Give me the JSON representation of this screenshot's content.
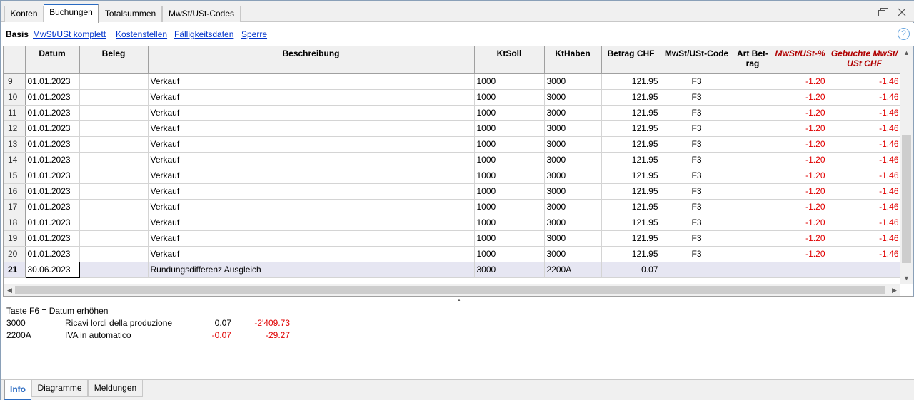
{
  "tabs": [
    {
      "label": "Konten"
    },
    {
      "label": "Buchungen"
    },
    {
      "label": "Totalsummen"
    },
    {
      "label": "MwSt/USt-Codes"
    }
  ],
  "active_tab": "Buchungen",
  "subnav": {
    "current": "Basis",
    "links": [
      "MwSt/USt komplett",
      "Kostenstellen",
      "Fälligkeitsdaten",
      "Sperre"
    ]
  },
  "table": {
    "columns": {
      "datum": "Datum",
      "beleg": "Beleg",
      "beschreibung": "Beschreibung",
      "ktsoll": "KtSoll",
      "kthaben": "KtHaben",
      "betrag": "Betrag CHF",
      "mwst_code": "MwSt/USt-Code",
      "art_betrag_1": "Art Bet-",
      "art_betrag_2": "rag",
      "mwst_pct": "MwSt/USt-%",
      "gebucht_1": "Gebuchte MwSt/",
      "gebucht_2": "USt CHF"
    },
    "rows": [
      {
        "n": "9",
        "datum": "01.01.2023",
        "beleg": "",
        "beschreibung": "Verkauf",
        "ktsoll": "1000",
        "kthaben": "3000",
        "betrag": "121.95",
        "code": "F3",
        "art": "",
        "pct": "-1.20",
        "gebucht": "-1.46"
      },
      {
        "n": "10",
        "datum": "01.01.2023",
        "beleg": "",
        "beschreibung": "Verkauf",
        "ktsoll": "1000",
        "kthaben": "3000",
        "betrag": "121.95",
        "code": "F3",
        "art": "",
        "pct": "-1.20",
        "gebucht": "-1.46"
      },
      {
        "n": "11",
        "datum": "01.01.2023",
        "beleg": "",
        "beschreibung": "Verkauf",
        "ktsoll": "1000",
        "kthaben": "3000",
        "betrag": "121.95",
        "code": "F3",
        "art": "",
        "pct": "-1.20",
        "gebucht": "-1.46"
      },
      {
        "n": "12",
        "datum": "01.01.2023",
        "beleg": "",
        "beschreibung": "Verkauf",
        "ktsoll": "1000",
        "kthaben": "3000",
        "betrag": "121.95",
        "code": "F3",
        "art": "",
        "pct": "-1.20",
        "gebucht": "-1.46"
      },
      {
        "n": "13",
        "datum": "01.01.2023",
        "beleg": "",
        "beschreibung": "Verkauf",
        "ktsoll": "1000",
        "kthaben": "3000",
        "betrag": "121.95",
        "code": "F3",
        "art": "",
        "pct": "-1.20",
        "gebucht": "-1.46"
      },
      {
        "n": "14",
        "datum": "01.01.2023",
        "beleg": "",
        "beschreibung": "Verkauf",
        "ktsoll": "1000",
        "kthaben": "3000",
        "betrag": "121.95",
        "code": "F3",
        "art": "",
        "pct": "-1.20",
        "gebucht": "-1.46"
      },
      {
        "n": "15",
        "datum": "01.01.2023",
        "beleg": "",
        "beschreibung": "Verkauf",
        "ktsoll": "1000",
        "kthaben": "3000",
        "betrag": "121.95",
        "code": "F3",
        "art": "",
        "pct": "-1.20",
        "gebucht": "-1.46"
      },
      {
        "n": "16",
        "datum": "01.01.2023",
        "beleg": "",
        "beschreibung": "Verkauf",
        "ktsoll": "1000",
        "kthaben": "3000",
        "betrag": "121.95",
        "code": "F3",
        "art": "",
        "pct": "-1.20",
        "gebucht": "-1.46"
      },
      {
        "n": "17",
        "datum": "01.01.2023",
        "beleg": "",
        "beschreibung": "Verkauf",
        "ktsoll": "1000",
        "kthaben": "3000",
        "betrag": "121.95",
        "code": "F3",
        "art": "",
        "pct": "-1.20",
        "gebucht": "-1.46"
      },
      {
        "n": "18",
        "datum": "01.01.2023",
        "beleg": "",
        "beschreibung": "Verkauf",
        "ktsoll": "1000",
        "kthaben": "3000",
        "betrag": "121.95",
        "code": "F3",
        "art": "",
        "pct": "-1.20",
        "gebucht": "-1.46"
      },
      {
        "n": "19",
        "datum": "01.01.2023",
        "beleg": "",
        "beschreibung": "Verkauf",
        "ktsoll": "1000",
        "kthaben": "3000",
        "betrag": "121.95",
        "code": "F3",
        "art": "",
        "pct": "-1.20",
        "gebucht": "-1.46"
      },
      {
        "n": "20",
        "datum": "01.01.2023",
        "beleg": "",
        "beschreibung": "Verkauf",
        "ktsoll": "1000",
        "kthaben": "3000",
        "betrag": "121.95",
        "code": "F3",
        "art": "",
        "pct": "-1.20",
        "gebucht": "-1.46"
      },
      {
        "n": "21",
        "datum": "30.06.2023",
        "beleg": "",
        "beschreibung": "Rundungsdifferenz Ausgleich",
        "ktsoll": "3000",
        "kthaben": "2200A",
        "betrag": "0.07",
        "code": "",
        "art": "",
        "pct": "",
        "gebucht": "",
        "selected": true
      }
    ]
  },
  "info": {
    "hint": "Taste F6 = Datum erhöhen",
    "lines": [
      {
        "account": "3000",
        "description": "Ricavi lordi della produzione",
        "amount": "0.07",
        "balance": "-2'409.73"
      },
      {
        "account": "2200A",
        "description": "IVA in automatico",
        "amount": "-0.07",
        "balance": "-29.27"
      }
    ]
  },
  "bottom_tabs": [
    {
      "label": "Info"
    },
    {
      "label": "Diagramme"
    },
    {
      "label": "Meldungen"
    }
  ],
  "icons": {
    "restore": "restore-window-icon",
    "help": "help-icon",
    "help_glyph": "?",
    "scroll_up": "▲",
    "scroll_down": "▼",
    "scroll_left": "◀",
    "scroll_right": "▶",
    "splitter": "▲"
  },
  "colors": {
    "negative": "#e00000",
    "link": "#0033cc",
    "accent": "#2a6bc2",
    "selected_row": "#e6e6f2"
  }
}
